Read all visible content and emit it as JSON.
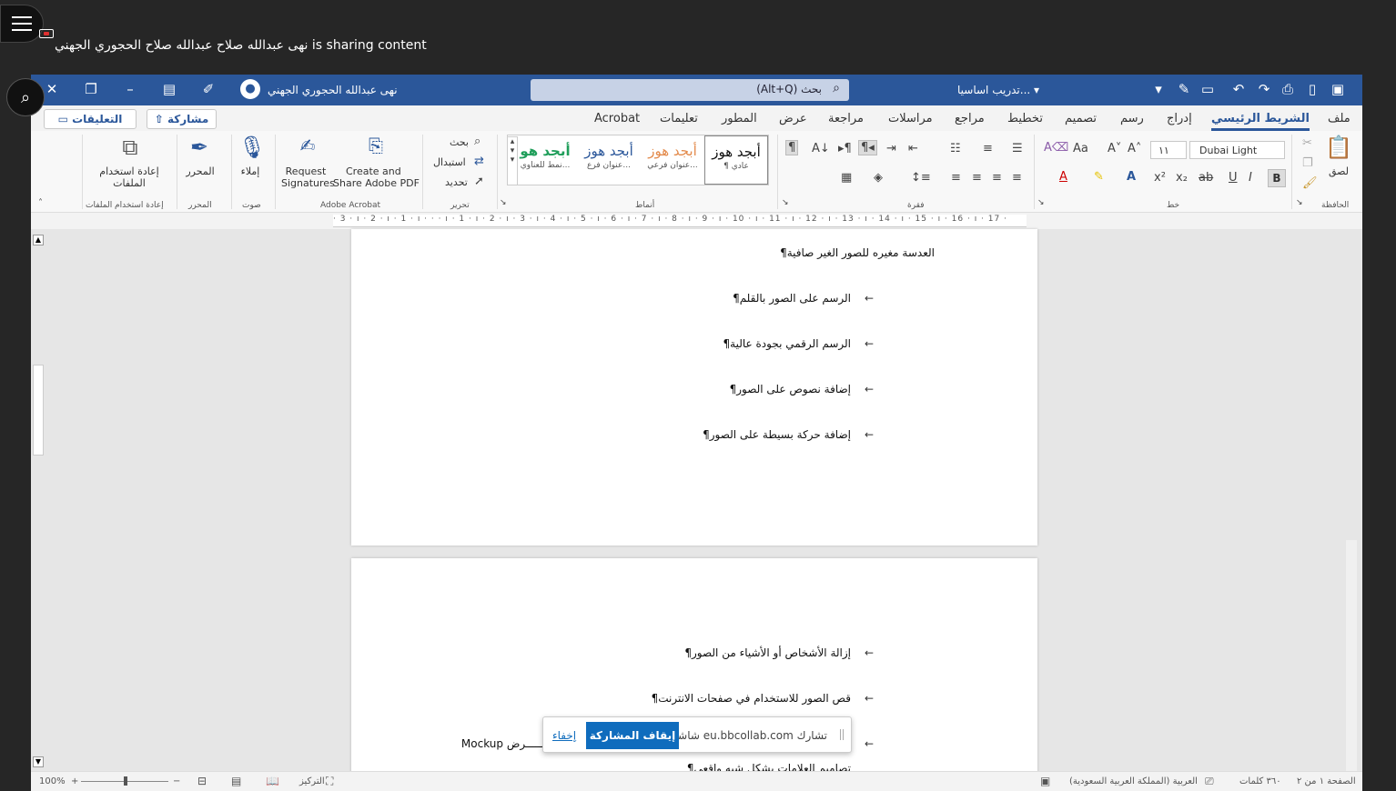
{
  "collab": {
    "sharer_text": "نهى عبدالله صلاح عبدالله صلاح الحجوري الجهني is sharing content"
  },
  "titlebar": {
    "doc_title": "تدريب اساسيا... ▾",
    "search_placeholder": "بحث (Alt+Q)",
    "user_name": "نهى عبدالله الحجوري الجهني"
  },
  "tabs": [
    "ملف",
    "الشريط الرئيسي",
    "إدراج",
    "رسم",
    "تصميم",
    "تخطيط",
    "مراجع",
    "مراسلات",
    "مراجعة",
    "عرض",
    "المطور",
    "تعليمات",
    "Acrobat"
  ],
  "active_tab": "الشريط الرئيسي",
  "header_buttons": {
    "share": "مشاركة",
    "comments": "التعليقات"
  },
  "ribbon": {
    "clipboard": {
      "paste": "لصق",
      "group": "الحافظة"
    },
    "font": {
      "name": "Dubai Light",
      "size": "١١",
      "group": "خط"
    },
    "paragraph": {
      "group": "فقرة"
    },
    "styles": {
      "group": "أنماط",
      "items": [
        {
          "sample": "أبجد هوز",
          "label": "¶ عادي"
        },
        {
          "sample": "أبجد هوز",
          "label": "عنوان فرعي..."
        },
        {
          "sample": "أبجد هوز",
          "label": "عنوان فرع..."
        },
        {
          "sample": "أبجد هو",
          "label": "نمط للعناوي..."
        }
      ]
    },
    "editing": {
      "find": "بحث",
      "replace": "استبدال",
      "select": "تحديد",
      "group": "تحرير"
    },
    "acrobat": {
      "create": "Create and Share Adobe PDF",
      "create_l1": "Create and",
      "create_l2": "Share Adobe PDF",
      "request_l1": "Request",
      "request_l2": "Signatures",
      "group": "Adobe Acrobat"
    },
    "voice": {
      "dictate": "إملاء",
      "group": "صوت"
    },
    "editor": {
      "label": "المحرر",
      "group": "المحرر"
    },
    "reuse": {
      "label_l1": "إعادة استخدام",
      "label_l2": "الملفات",
      "group": "إعادة استخدام الملفات"
    }
  },
  "ruler": "· 3 · ı · 2 · ı · 1 · ı · · · ı · 1 · ı · 2 · ı · 3 · ı · 4 · ı · 5 · ı · 6 · ı · 7 · ı · 8 · ı · 9 · ı · 10 · ı · 11 · ı · 12 · ı · 13 · ı · 14 · ı · 15 · ı · 16 · ı · 17 ·",
  "page1_lines": [
    "العدسة مغيره للصور الغير صافية¶",
    "الرسم على الصور بالقلم¶",
    "الرسم الرقمي بجودة عالية¶",
    "إضافة نصوص على الصور¶",
    "إضافة حركة بسيطة على الصور¶"
  ],
  "page2_lines": [
    "إزالة الأشخاص أو الأشياء من الصور¶",
    "قص الصور للاستخدام في صفحات الانترنت¶",
    "Mockup لعـــــرض",
    "تصاميم العلامات بشكل شبه واقعي¶"
  ],
  "statusbar": {
    "page": "الصفحة ١ من ٢",
    "words": "٣٦٠ كلمات",
    "language": "العربية (المملكة العربية السعودية)",
    "focus": "التركيز",
    "zoom": "100%"
  },
  "toast": {
    "message": "تشارك eu.bbcollab.com شاشتك.",
    "stop": "إيقاف المشاركة",
    "hide": "إخفاء"
  },
  "colors": {
    "word_blue": "#2b579a",
    "stop_blue": "#0f6cbd"
  }
}
